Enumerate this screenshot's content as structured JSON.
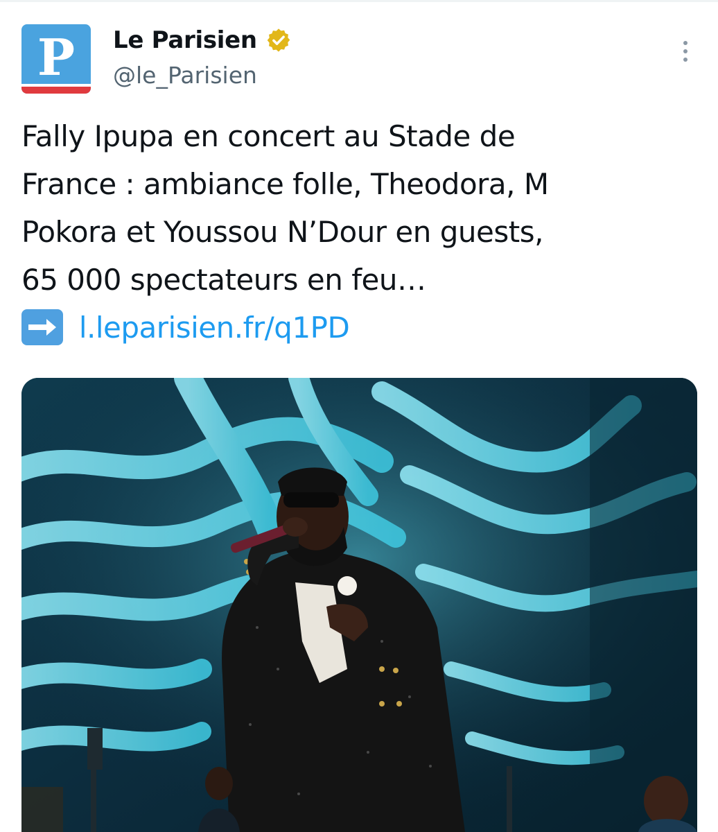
{
  "account": {
    "display_name": "Le Parisien",
    "handle": "@le_Parisien",
    "avatar_letter": "P",
    "verified_badge": "verified-gold-icon",
    "brand_color": "#4aa3df",
    "brand_accent": "#e03a3e"
  },
  "tweet": {
    "lines": [
      "Fally Ipupa en concert au Stade de",
      "France : ambiance folle, Theodora, M",
      "Pokora et Youssou N’Dour en guests,",
      "65 000 spectateurs en feu…"
    ],
    "arrow_icon": "right-arrow-emoji-icon",
    "link_text": "l.leparisien.fr/q1PD",
    "link_color": "#1d9bf0"
  },
  "media": {
    "icon": "concert-photo"
  },
  "more_icon": "more-options-icon"
}
